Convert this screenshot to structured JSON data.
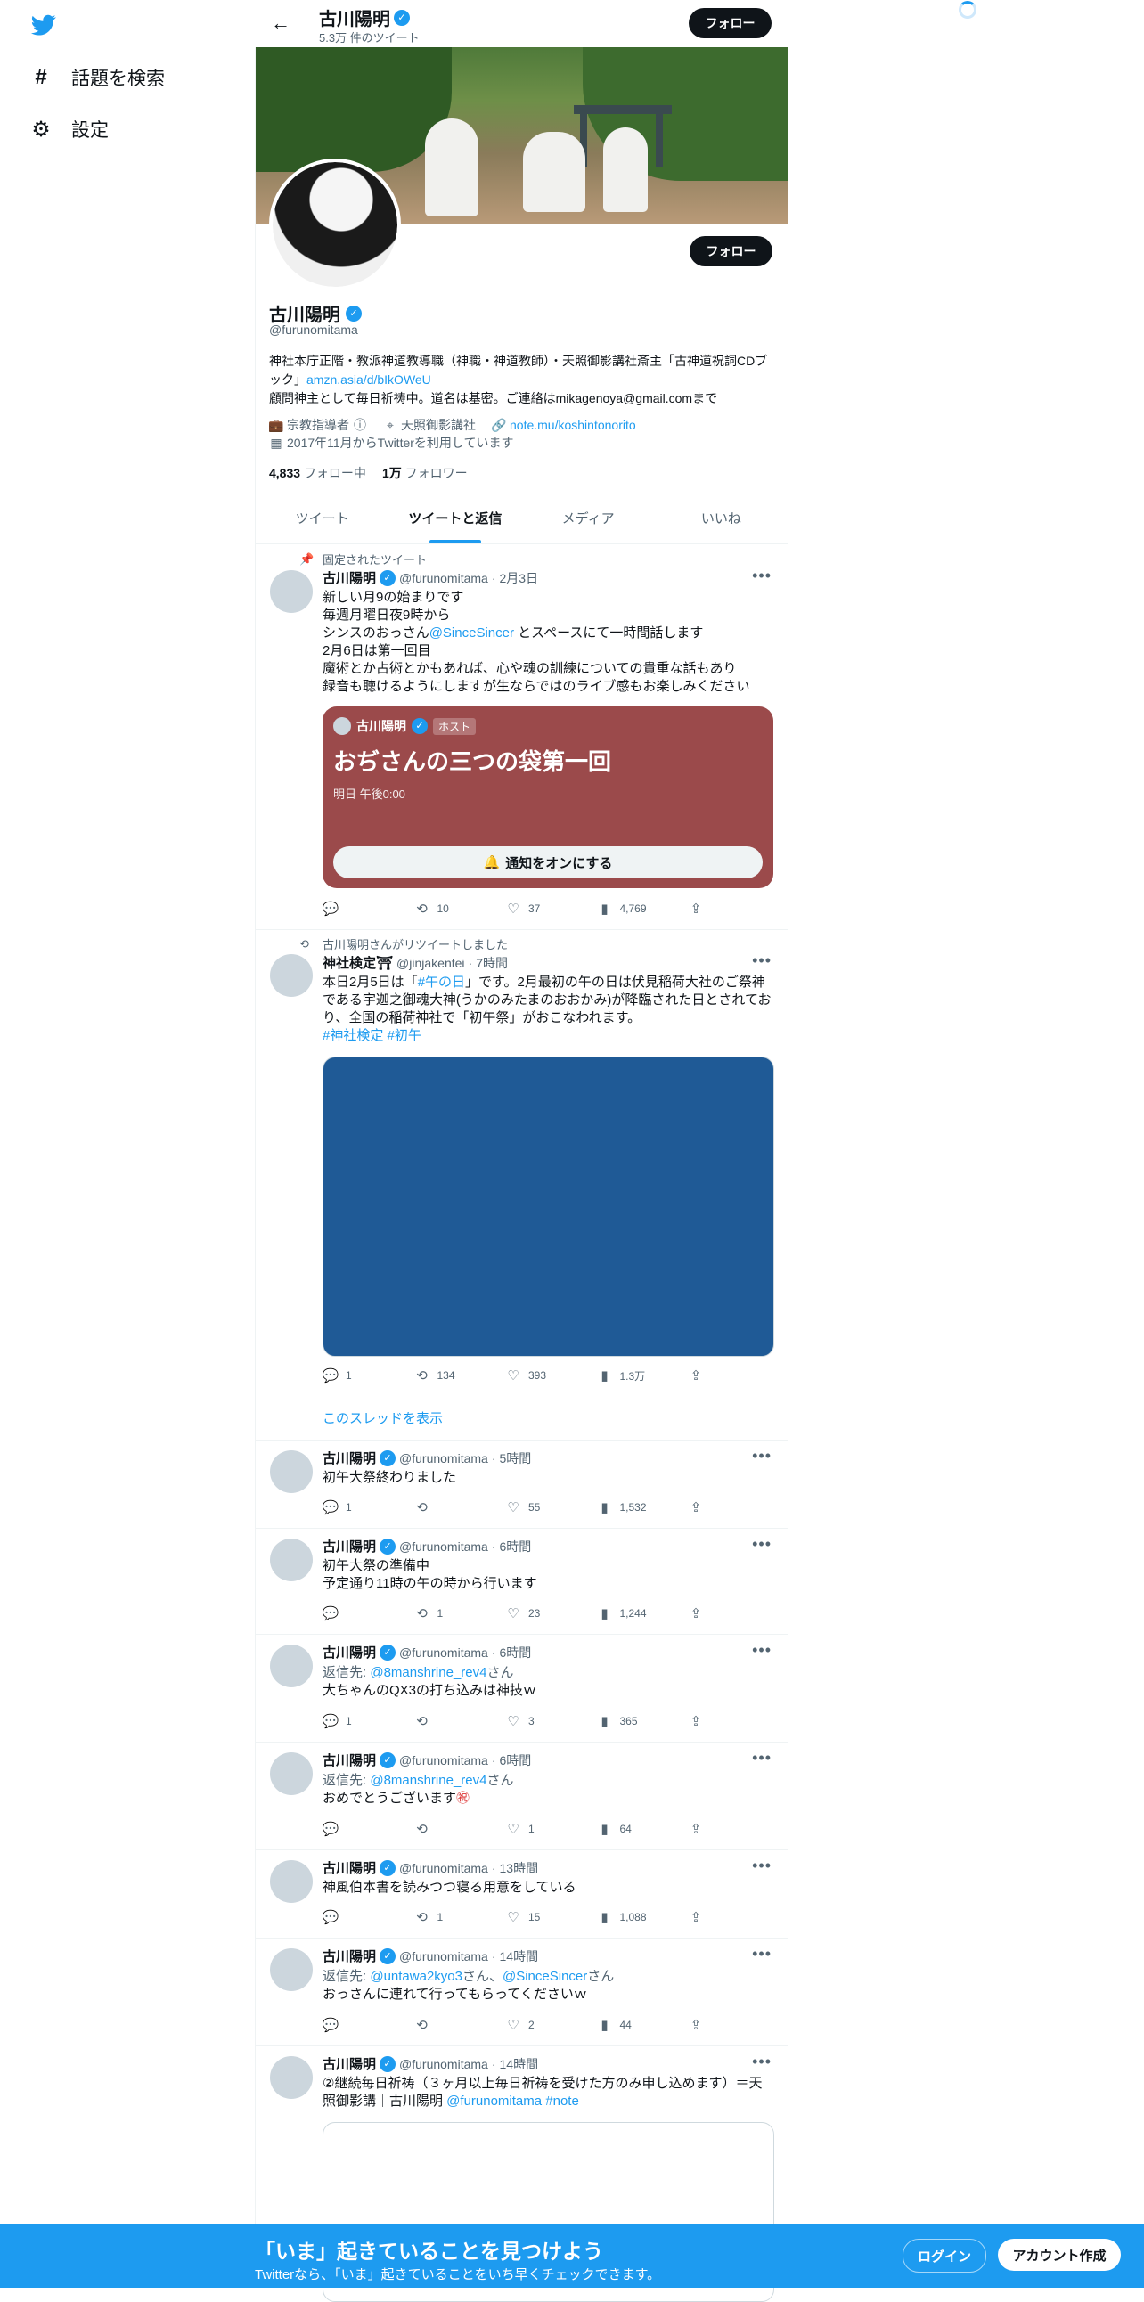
{
  "nav": {
    "logo": "twitter-bird-icon",
    "items": [
      {
        "label": "話題を検索",
        "icon": "hashtag-icon"
      },
      {
        "label": "設定",
        "icon": "gear-icon"
      }
    ]
  },
  "header": {
    "name": "古川陽明",
    "tweet_count": "5.3万 件のツイート",
    "follow_label": "フォロー"
  },
  "profile": {
    "name": "古川陽明",
    "handle": "@furunomitama",
    "follow_label": "フォロー",
    "bio_line1": "神社本庁正階・教派神道教導職（神職・神道教師）・天照御影講社斎主「古神道祝詞CDブック」",
    "bio_link": "amzn.asia/d/bIkOWeU",
    "bio_line2": "顧問神主として毎日祈祷中。道名は基密。ご連絡はmikagenoya@gmail.comまで",
    "category": "宗教指導者",
    "location": "天照御影講社",
    "website": "note.mu/koshintonorito",
    "joined": "2017年11月からTwitterを利用しています",
    "following_count": "4,833",
    "following_label": "フォロー中",
    "followers_count": "1万",
    "followers_label": "フォロワー"
  },
  "tabs": [
    {
      "label": "ツイート"
    },
    {
      "label": "ツイートと返信"
    },
    {
      "label": "メディア"
    },
    {
      "label": "いいね"
    }
  ],
  "tweets": {
    "pinned": {
      "context": "固定されたツイート",
      "name": "古川陽明",
      "handle": "@furunomitama",
      "time": "2月3日",
      "line1": "新しい月9の始まりです",
      "line2": "毎週月曜日夜9時から",
      "line3_pre": "シンスのおっさん",
      "line3_mention": "@SinceSincer",
      "line3_post": " とスペースにて一時間話します",
      "line4": "2月6日は第一回目",
      "line5": "魔術とか占術とかもあれば、心や魂の訓練についての貴重な話もあり",
      "line6": "録音も聴けるようにしますが生ならではのライブ感もお楽しみください",
      "space": {
        "host_name": "古川陽明",
        "host_badge": "ホスト",
        "title": "おぢさんの三つの袋第一回",
        "time": "明日 午後0:00",
        "button": "通知をオンにする"
      },
      "replies": "",
      "retweets": "10",
      "likes": "37",
      "views": "4,769"
    },
    "retweet": {
      "context": "古川陽明さんがリツイートしました",
      "name": "神社検定⛩",
      "handle": "@jinjakentei",
      "time": "7時間",
      "body_pre": "本日2月5日は「",
      "body_tag": "#午の日",
      "body_post": "」です。2月最初の午の日は伏見稲荷大社のご祭神である宇迦之御魂大神(うかのみたまのおおかみ)が降臨された日とされており、全国の稲荷神社で「初午祭」がおこなわれます。",
      "tags": "#神社検定 #初午",
      "replies": "1",
      "retweets": "134",
      "likes": "393",
      "views": "1.3万",
      "show_thread": "このスレッドを表示"
    },
    "t3": {
      "name": "古川陽明",
      "handle": "@furunomitama",
      "time": "5時間",
      "body": "初午大祭終わりました",
      "replies": "1",
      "retweets": "",
      "likes": "55",
      "views": "1,532"
    },
    "t4": {
      "name": "古川陽明",
      "handle": "@furunomitama",
      "time": "6時間",
      "body": "初午大祭の準備中\n予定通り11時の午の時から行います",
      "replies": "",
      "retweets": "1",
      "likes": "23",
      "views": "1,244"
    },
    "t5": {
      "name": "古川陽明",
      "handle": "@furunomitama",
      "time": "6時間",
      "reply_to_label": "返信先: ",
      "reply_to": "@8manshrine_rev4",
      "reply_suffix": "さん",
      "body": "大ちゃんのQX3の打ち込みは神技ｗ",
      "replies": "1",
      "retweets": "",
      "likes": "3",
      "views": "365"
    },
    "t6": {
      "name": "古川陽明",
      "handle": "@furunomitama",
      "time": "6時間",
      "reply_to_label": "返信先: ",
      "reply_to": "@8manshrine_rev4",
      "reply_suffix": "さん",
      "body": "おめでとうございます",
      "emoji": "㊗",
      "replies": "",
      "retweets": "",
      "likes": "1",
      "views": "64"
    },
    "t7": {
      "name": "古川陽明",
      "handle": "@furunomitama",
      "time": "13時間",
      "body": "神風伯本書を読みつつ寝る用意をしている",
      "replies": "",
      "retweets": "1",
      "likes": "15",
      "views": "1,088"
    },
    "t8": {
      "name": "古川陽明",
      "handle": "@furunomitama",
      "time": "14時間",
      "reply_to_label": "返信先: ",
      "reply_to": "@untawa2kyo3",
      "reply_mid": "さん、",
      "reply_to2": "@SinceSincer",
      "reply_suffix": "さん",
      "body": "おっさんに連れて行ってもらってくださいｗ",
      "replies": "",
      "retweets": "",
      "likes": "2",
      "views": "44"
    },
    "t9": {
      "name": "古川陽明",
      "handle": "@furunomitama",
      "time": "14時間",
      "body_pre": "②継続毎日祈祷（３ヶ月以上毎日祈祷を受けた方のみ申し込めます）＝天照御影講｜古川陽明 ",
      "body_mention": "@furunomitama",
      "body_tag": " #note"
    }
  },
  "bottom_bar": {
    "title": "「いま」起きていることを見つけよう",
    "subtitle": "Twitterなら、「いま」起きていることをいち早くチェックできます。",
    "login": "ログイン",
    "signup": "アカウント作成"
  },
  "colors": {
    "accent": "#1d9bf0",
    "space_card": "#9b4a4b",
    "media": "#1f5a96",
    "bottom_bar": "#1d9bf0"
  }
}
